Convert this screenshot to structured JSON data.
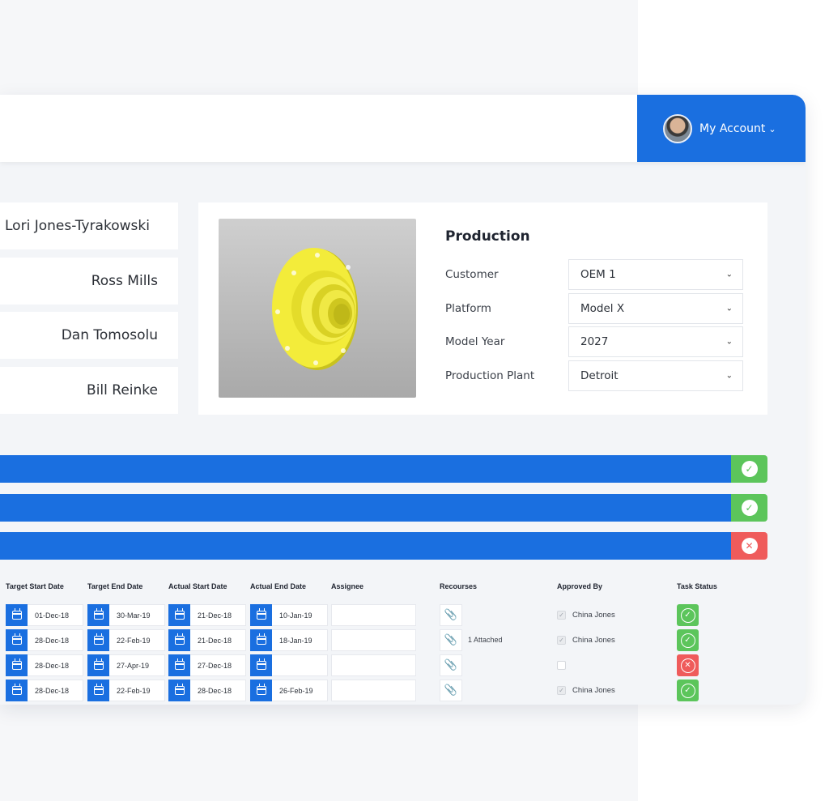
{
  "account": {
    "label": "My Account",
    "chevron": "⌄"
  },
  "people": [
    "Lori Jones-Tyrakowski",
    "Ross Mills",
    "Dan Tomosolu",
    "Bill Reinke"
  ],
  "production": {
    "title": "Production",
    "fields": [
      {
        "label": "Customer",
        "value": "OEM 1"
      },
      {
        "label": "Platform",
        "value": "Model X"
      },
      {
        "label": "Model Year",
        "value": "2027"
      },
      {
        "label": "Production Plant",
        "value": "Detroit"
      }
    ]
  },
  "bars": [
    {
      "status": "complete"
    },
    {
      "status": "complete"
    },
    {
      "status": "rejected"
    }
  ],
  "table": {
    "headers": {
      "target_start": "Target Start Date",
      "target_end": "Target End Date",
      "actual_start": "Actual Start Date",
      "actual_end": "Actual End Date",
      "assignee": "Assignee",
      "resources": "Recourses",
      "approved_by": "Approved By",
      "task_status": "Task Status"
    },
    "rows": [
      {
        "target_start": "01-Dec-18",
        "target_end": "30-Mar-19",
        "actual_start": "21-Dec-18",
        "actual_end": "10-Jan-19",
        "attachments": "",
        "approved": true,
        "approver": "China Jones",
        "status": "complete"
      },
      {
        "target_start": "28-Dec-18",
        "target_end": "22-Feb-19",
        "actual_start": "21-Dec-18",
        "actual_end": "18-Jan-19",
        "attachments": "1 Attached",
        "approved": true,
        "approver": "China Jones",
        "status": "complete"
      },
      {
        "target_start": "28-Dec-18",
        "target_end": "27-Apr-19",
        "actual_start": "27-Dec-18",
        "actual_end": "",
        "attachments": "",
        "approved": false,
        "approver": "",
        "status": "rejected"
      },
      {
        "target_start": "28-Dec-18",
        "target_end": "22-Feb-19",
        "actual_start": "28-Dec-18",
        "actual_end": "26-Feb-19",
        "attachments": "",
        "approved": true,
        "approver": "China Jones",
        "status": "complete"
      }
    ]
  },
  "colors": {
    "primary": "#1a6fe0",
    "success": "#5cc55b",
    "danger": "#ef5b5b"
  },
  "icons": {
    "complete": "check-circle-icon",
    "rejected": "x-circle-icon",
    "calendar": "calendar-icon",
    "attachment": "paperclip-icon"
  }
}
